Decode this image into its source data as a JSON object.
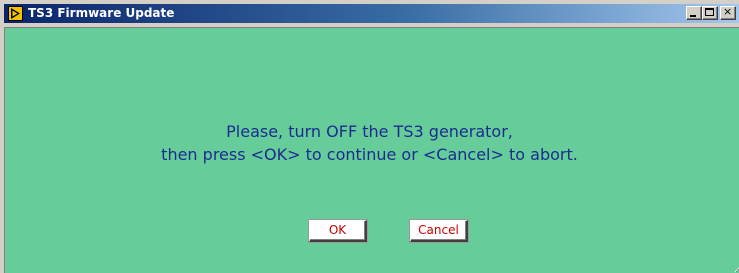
{
  "window": {
    "title": "TS3 Firmware Update",
    "app_icon": "labview-run-icon",
    "controls": {
      "minimize_icon": "minimize-icon",
      "maximize_icon": "maximize-icon",
      "close_icon": "close-icon",
      "close_glyph": "×"
    }
  },
  "dialog": {
    "message_line1": "Please, turn OFF the TS3 generator,",
    "message_line2": "then press <OK> to continue or <Cancel> to abort.",
    "ok_label": "OK",
    "cancel_label": "Cancel"
  },
  "colors": {
    "panel_background": "#66cc99",
    "message_text": "#1a2d8f",
    "button_text": "#cc0000",
    "titlebar_start": "#0a246a"
  }
}
